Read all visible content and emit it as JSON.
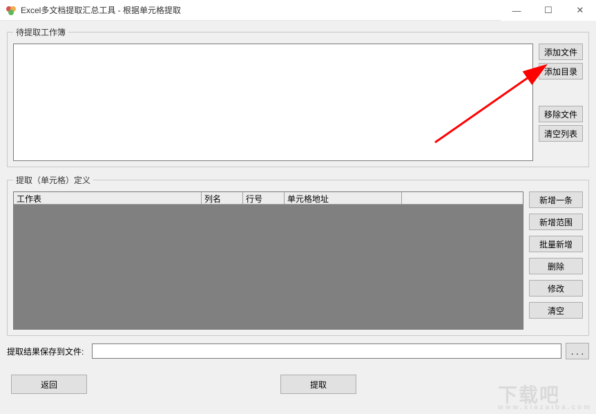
{
  "window": {
    "title": "Excel多文档提取汇总工具 - 根据单元格提取",
    "minimize": "—",
    "maximize": "☐",
    "close": "✕"
  },
  "group_workbooks": {
    "legend": "待提取工作簿",
    "buttons": {
      "add_file": "添加文件",
      "add_dir": "添加目录",
      "remove_file": "移除文件",
      "clear_list": "清空列表"
    }
  },
  "group_def": {
    "legend": "提取（单元格）定义",
    "headers": {
      "sheet": "工作表",
      "col": "列名",
      "row": "行号",
      "addr": "单元格地址"
    },
    "buttons": {
      "add_one": "新增一条",
      "add_range": "新增范围",
      "add_batch": "批量新增",
      "delete": "删除",
      "edit": "修改",
      "clear": "清空"
    }
  },
  "save": {
    "label": "提取结果保存到文件:",
    "value": "",
    "browse": ". . ."
  },
  "bottom": {
    "back": "返回",
    "extract": "提取"
  },
  "watermark": {
    "main": "下载吧",
    "sub": "www.xiazaiba.com"
  }
}
